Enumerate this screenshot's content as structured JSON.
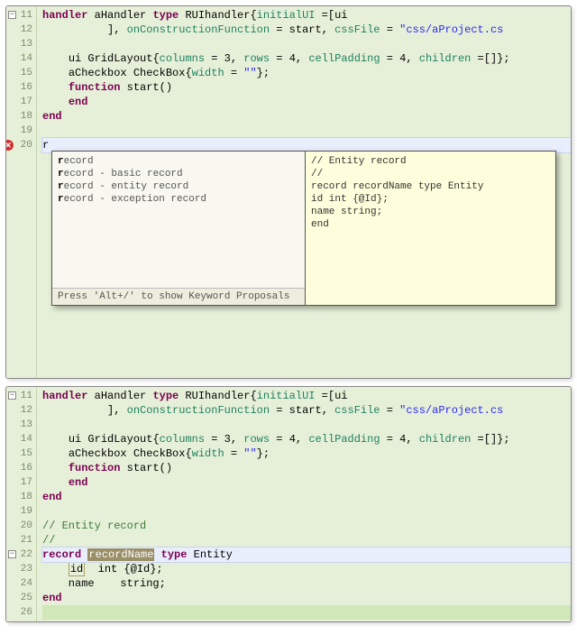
{
  "top": {
    "lineStart": 11,
    "lineEnd": 20,
    "cursorLine": 20,
    "code": {
      "l11": {
        "pre": "",
        "text": "handler aHandler type RUIhandler{initialUI =[ui"
      },
      "l12": {
        "pre": "          ",
        "text": "], onConstructionFunction = start, cssFile = \"css/aProject.cs"
      },
      "l13": "",
      "l14": {
        "pre": "    ",
        "text": "ui GridLayout{columns = 3, rows = 4, cellPadding = 4, children =[]};"
      },
      "l15": {
        "pre": "    ",
        "text": "aCheckbox CheckBox{width = \"\"};"
      },
      "l16": {
        "pre": "    ",
        "text": "function start()"
      },
      "l17": {
        "pre": "    ",
        "text": "end"
      },
      "l18": "end",
      "l19": "",
      "l20": "r"
    },
    "proposals": {
      "items": [
        {
          "bold": "r",
          "rest": "ecord"
        },
        {
          "bold": "r",
          "rest": "ecord - basic record"
        },
        {
          "bold": "r",
          "rest": "ecord - entity record"
        },
        {
          "bold": "r",
          "rest": "ecord - exception record"
        }
      ],
      "status": "Press 'Alt+/' to show Keyword Proposals",
      "doc": "// Entity record\n//\nrecord recordName type Entity\nid int {@Id};\nname string;\nend"
    }
  },
  "bottom": {
    "lineStart": 11,
    "lineEnd": 26,
    "code": {
      "l11": "handler aHandler type RUIhandler{initialUI =[ui",
      "l12": "          ], onConstructionFunction = start, cssFile = \"css/aProject.cs",
      "l13": "",
      "l14": "    ui GridLayout{columns = 3, rows = 4, cellPadding = 4, children =[]};",
      "l15": "    aCheckbox CheckBox{width = \"\"};",
      "l16": "    function start()",
      "l17": "    end",
      "l18": "end",
      "l19": "",
      "l20": "// Entity record",
      "l21": "//",
      "l22": {
        "kw1": "record ",
        "sel": "recordName",
        "mid": " ",
        "kw2": "type",
        "rest": " Entity"
      },
      "l23": {
        "pre": "    ",
        "box": "id",
        "rest": "  int {@Id};"
      },
      "l24": "    name    string;",
      "l25": "end",
      "l26": ""
    }
  }
}
